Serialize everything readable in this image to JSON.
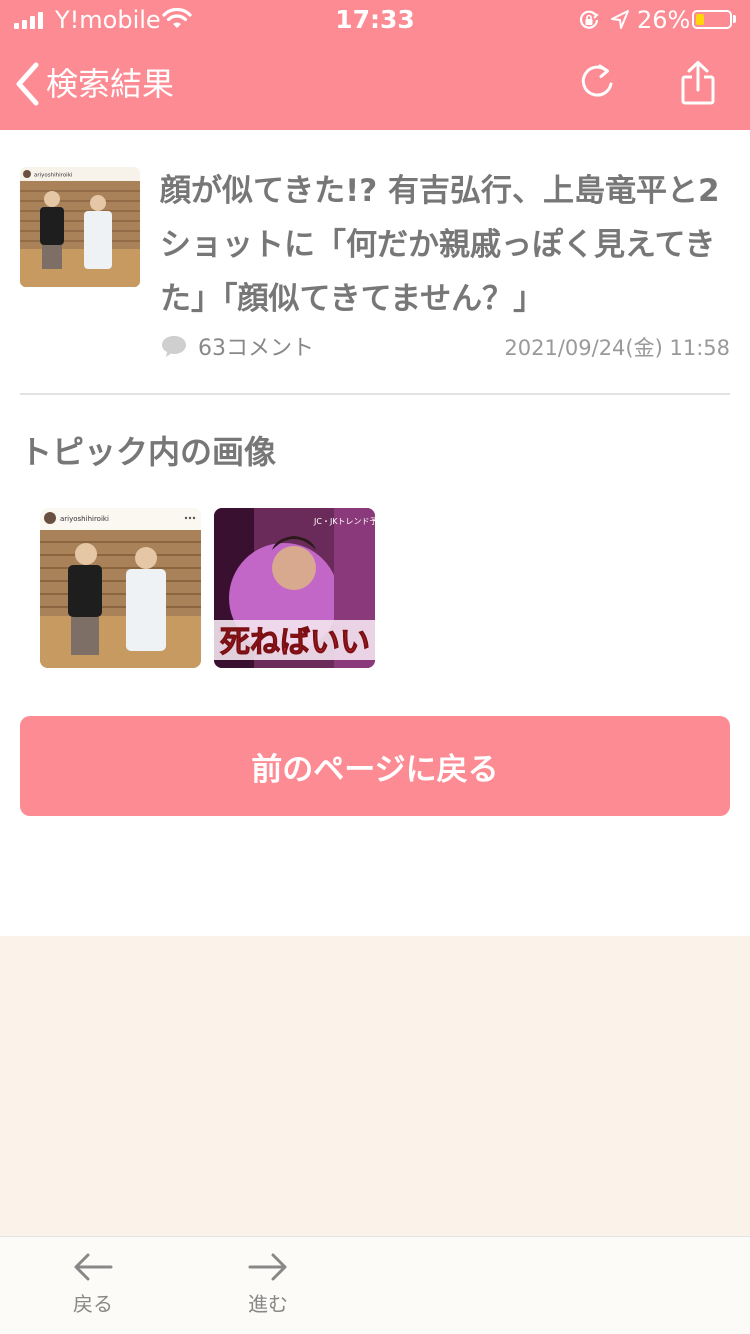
{
  "status": {
    "carrier": "Y!mobile",
    "time": "17:33",
    "battery": "26%",
    "battery_level": 0.26
  },
  "nav": {
    "back_label": "検索結果",
    "reload_icon": "reload-icon",
    "share_icon": "share-icon"
  },
  "article": {
    "title": "顔が似てきた!? 有吉弘行、上島竜平と2ショットに「何だか親戚っぽく見えてきた」「顔似てきてません？」",
    "comments": "63コメント",
    "date": "2021/09/24(金) 11:58",
    "thumb_account": "ariyoshihiroiki"
  },
  "images_section": {
    "title": "トピック内の画像",
    "images": [
      {
        "account": "ariyoshihiroiki"
      },
      {
        "caption": "死ねばいい",
        "corner_text": "JC・JKトレンド予測"
      }
    ]
  },
  "back_button": "前のページに戻る",
  "toolbar": {
    "back": "戻る",
    "forward": "進む"
  },
  "colors": {
    "accent": "#fd8b93",
    "footer_bg": "#fbf2e9"
  }
}
